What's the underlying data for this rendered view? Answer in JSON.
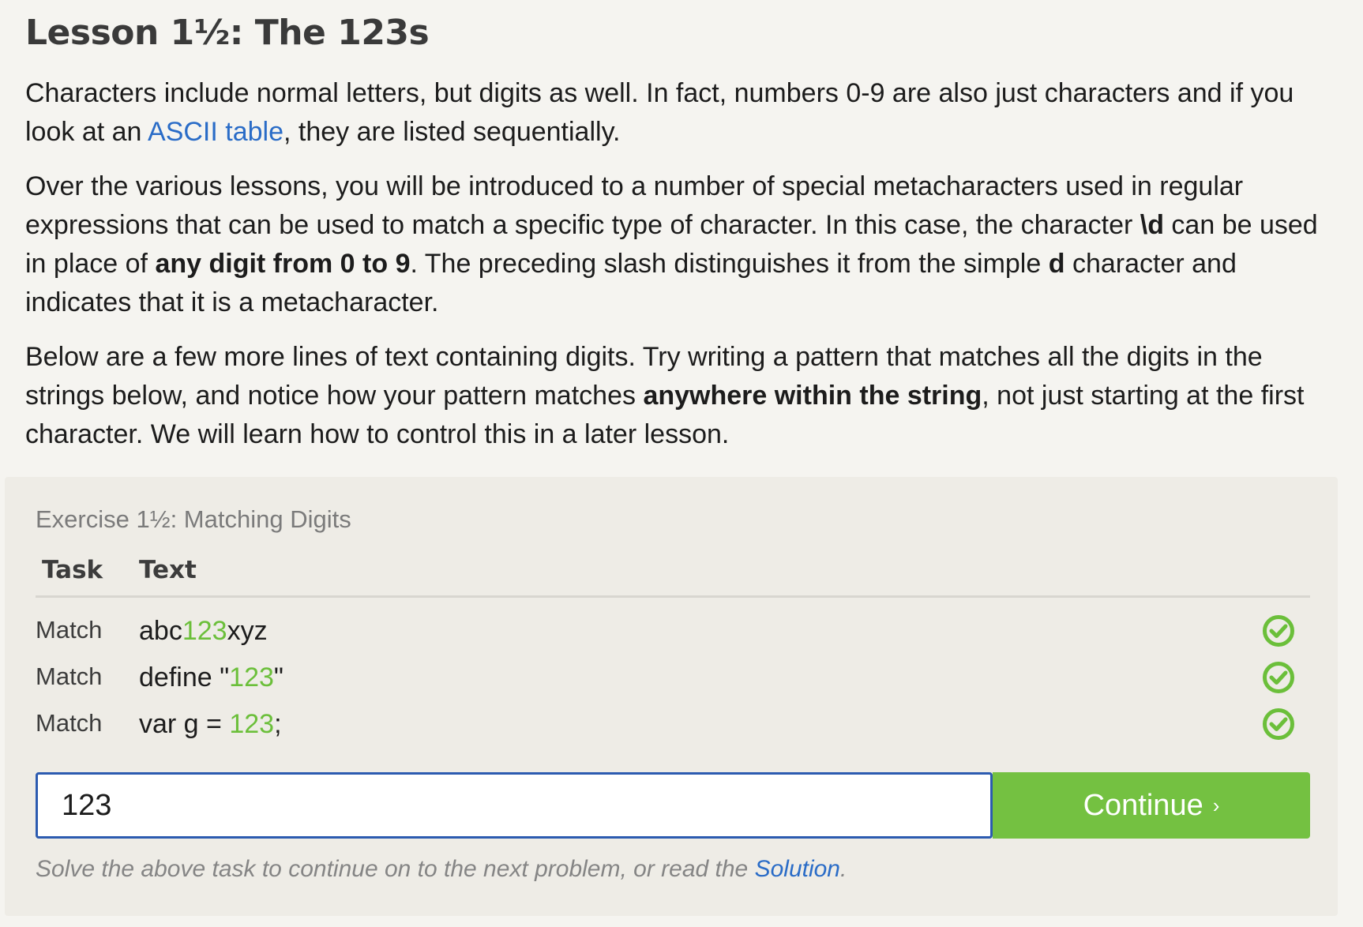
{
  "lesson": {
    "title": "Lesson 1½: The 123s",
    "p1": {
      "before": "Characters include normal letters, but digits as well. In fact, numbers 0-9 are also just characters and if you look at an ",
      "link": "ASCII table",
      "after": ", they are listed sequentially."
    },
    "p2": {
      "t1": "Over the various lessons, you will be introduced to a number of special metacharacters used in regular expressions that can be used to match a specific type of character. In this case, the character ",
      "b1": "\\d",
      "t2": " can be used in place of ",
      "b2": "any digit from 0 to 9",
      "t3": ". The preceding slash distinguishes it from the simple ",
      "b3": "d",
      "t4": " character and indicates that it is a metacharacter."
    },
    "p3": {
      "t1": "Below are a few more lines of text containing digits. Try writing a pattern that matches all the digits in the strings below, and notice how your pattern matches ",
      "b1": "anywhere within the string",
      "t2": ", not just starting at the first character. We will learn how to control this in a later lesson."
    }
  },
  "exercise": {
    "title": "Exercise 1½: Matching Digits",
    "headers": {
      "task": "Task",
      "text": "Text"
    },
    "rows": [
      {
        "task": "Match",
        "pre": "abc",
        "match": "123",
        "post": "xyz",
        "status_icon": "check-circle-icon"
      },
      {
        "task": "Match",
        "pre": "define \"",
        "match": "123",
        "post": "\"",
        "status_icon": "check-circle-icon"
      },
      {
        "task": "Match",
        "pre": "var g = ",
        "match": "123",
        "post": ";",
        "status_icon": "check-circle-icon"
      }
    ],
    "input_value": "123",
    "continue_label": "Continue",
    "continue_chevron": "›",
    "hint": {
      "before": "Solve the above task to continue on to the next problem, or read the ",
      "link": "Solution",
      "after": "."
    }
  },
  "colors": {
    "match_green": "#6bbf3a",
    "button_green": "#74c141",
    "link_blue": "#2a6cc7",
    "input_border": "#2c5bb0"
  }
}
